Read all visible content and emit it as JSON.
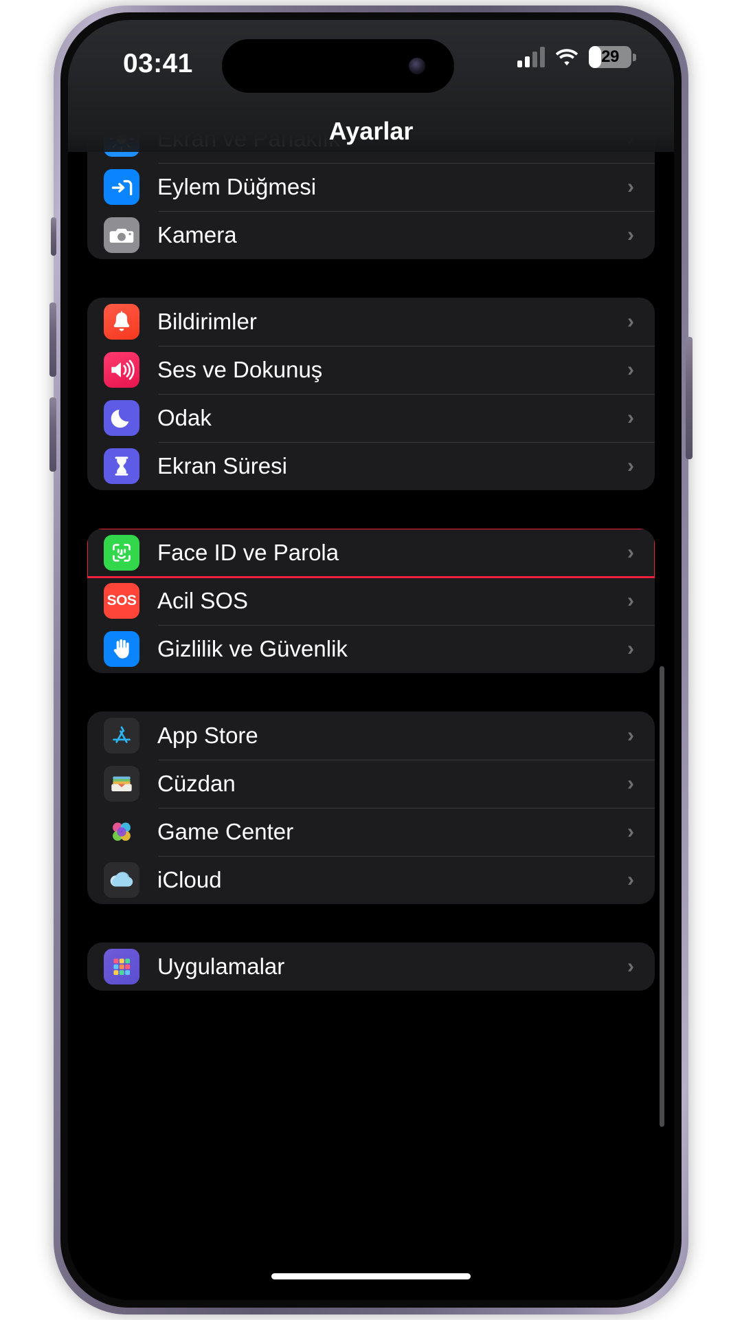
{
  "status_bar": {
    "time": "03:41",
    "silent_icon": "bell-slash-icon",
    "cellular_bars_filled": 2,
    "cellular_bars_total": 4,
    "wifi_icon": "wifi-icon",
    "battery_percent": "29",
    "battery_level": 29
  },
  "nav": {
    "title": "Ayarlar"
  },
  "colors": {
    "highlight": "#f0213c",
    "row_background": "#1c1c1e",
    "screen_background": "#000000",
    "label": "#ffffff",
    "chevron": "#6e6e73"
  },
  "groups": [
    {
      "name": "device-group",
      "rows": [
        {
          "label": "Ekran ve Parlaklık",
          "icon": "brightness-icon",
          "icon_class": "ic-display",
          "chevron": "›",
          "highlighted": false,
          "clipped_top": true
        },
        {
          "label": "Eylem Düğmesi",
          "icon": "action-button-icon",
          "icon_class": "ic-action",
          "chevron": "›",
          "highlighted": false
        },
        {
          "label": "Kamera",
          "icon": "camera-icon",
          "icon_class": "ic-camera",
          "chevron": "›",
          "highlighted": false
        }
      ]
    },
    {
      "name": "alerts-group",
      "rows": [
        {
          "label": "Bildirimler",
          "icon": "bell-icon",
          "icon_class": "ic-notif",
          "chevron": "›",
          "highlighted": false
        },
        {
          "label": "Ses ve Dokunuş",
          "icon": "speaker-icon",
          "icon_class": "ic-sound",
          "chevron": "›",
          "highlighted": false
        },
        {
          "label": "Odak",
          "icon": "moon-icon",
          "icon_class": "ic-focus",
          "chevron": "›",
          "highlighted": false
        },
        {
          "label": "Ekran Süresi",
          "icon": "hourglass-icon",
          "icon_class": "ic-screen",
          "chevron": "›",
          "highlighted": false
        }
      ]
    },
    {
      "name": "security-group",
      "rows": [
        {
          "label": "Face ID ve Parola",
          "icon": "face-id-icon",
          "icon_class": "ic-faceid",
          "chevron": "›",
          "highlighted": true
        },
        {
          "label": "Acil SOS",
          "icon": "sos-icon",
          "icon_class": "ic-sos",
          "chevron": "›",
          "highlighted": false
        },
        {
          "label": "Gizlilik ve Güvenlik",
          "icon": "hand-raised-icon",
          "icon_class": "ic-privacy",
          "chevron": "›",
          "highlighted": false
        }
      ]
    },
    {
      "name": "services-group",
      "rows": [
        {
          "label": "App Store",
          "icon": "app-store-icon",
          "icon_class": "ic-appstore",
          "chevron": "›",
          "highlighted": false
        },
        {
          "label": "Cüzdan",
          "icon": "wallet-icon",
          "icon_class": "ic-wallet",
          "chevron": "›",
          "highlighted": false
        },
        {
          "label": "Game Center",
          "icon": "game-center-icon",
          "icon_class": "ic-gamecenter",
          "chevron": "›",
          "highlighted": false
        },
        {
          "label": "iCloud",
          "icon": "icloud-icon",
          "icon_class": "ic-icloud",
          "chevron": "›",
          "highlighted": false
        }
      ]
    },
    {
      "name": "apps-group",
      "rows": [
        {
          "label": "Uygulamalar",
          "icon": "apps-grid-icon",
          "icon_class": "ic-apps",
          "chevron": "›",
          "highlighted": false
        }
      ]
    }
  ]
}
